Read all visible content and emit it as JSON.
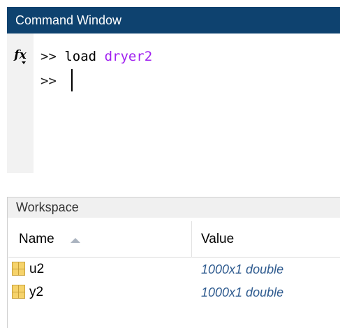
{
  "command_window": {
    "title": "Command Window",
    "fx_label": "fx",
    "lines": [
      {
        "prompt": ">>",
        "command": "load",
        "argument": "dryer2"
      },
      {
        "prompt": ">>",
        "command": "",
        "argument": ""
      }
    ],
    "colors": {
      "title_bar": "#0e426f",
      "keyword": "#a020f0"
    }
  },
  "workspace": {
    "title": "Workspace",
    "columns": [
      "Name",
      "Value"
    ],
    "sort": {
      "column": "Name",
      "direction": "ascending"
    },
    "variables": [
      {
        "name": "u2",
        "value": "1000x1 double",
        "icon": "matrix-variable-icon"
      },
      {
        "name": "y2",
        "value": "1000x1 double",
        "icon": "matrix-variable-icon"
      }
    ]
  }
}
